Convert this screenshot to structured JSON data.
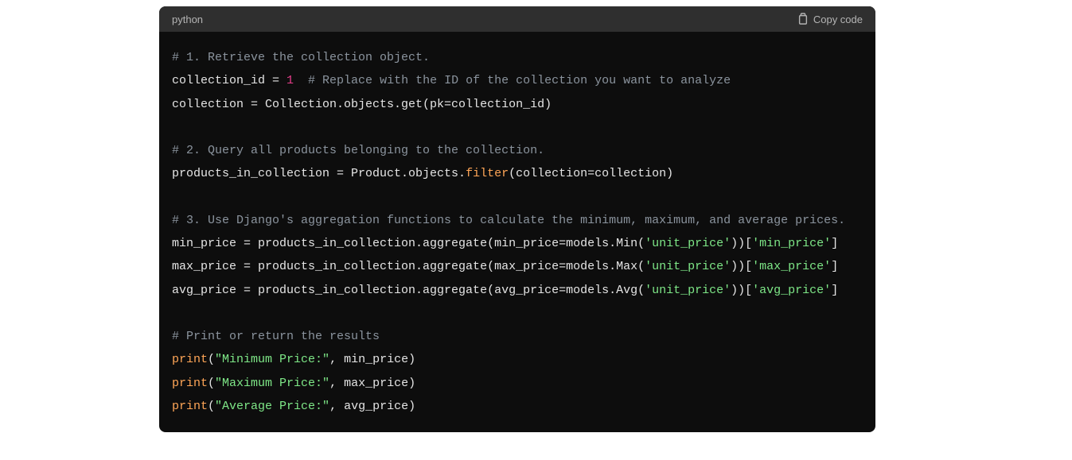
{
  "header": {
    "language": "python",
    "copy_label": "Copy code"
  },
  "code": {
    "c1": "# 1. Retrieve the collection object.",
    "l2a": "collection_id = ",
    "l2num": "1",
    "l2c": "  # Replace with the ID of the collection you want to analyze",
    "l3": "collection = Collection.objects.get(pk=collection_id)",
    "c2": "# 2. Query all products belonging to the collection.",
    "l5a": "products_in_collection = Product.objects.",
    "l5fn": "filter",
    "l5b": "(collection=collection)",
    "c3": "# 3. Use Django's aggregation functions to calculate the minimum, maximum, and average prices.",
    "l7a": "min_price = products_in_collection.aggregate(min_price=models.Min(",
    "l7s1": "'unit_price'",
    "l7b": "))[",
    "l7s2": "'min_price'",
    "l7c": "]",
    "l8a": "max_price = products_in_collection.aggregate(max_price=models.Max(",
    "l8s1": "'unit_price'",
    "l8b": "))[",
    "l8s2": "'max_price'",
    "l8c": "]",
    "l9a": "avg_price = products_in_collection.aggregate(avg_price=models.Avg(",
    "l9s1": "'unit_price'",
    "l9b": "))[",
    "l9s2": "'avg_price'",
    "l9c": "]",
    "c4": "# Print or return the results",
    "p1fn": "print",
    "p1a": "(",
    "p1s": "\"Minimum Price:\"",
    "p1b": ", min_price)",
    "p2fn": "print",
    "p2a": "(",
    "p2s": "\"Maximum Price:\"",
    "p2b": ", max_price)",
    "p3fn": "print",
    "p3a": "(",
    "p3s": "\"Average Price:\"",
    "p3b": ", avg_price)"
  }
}
